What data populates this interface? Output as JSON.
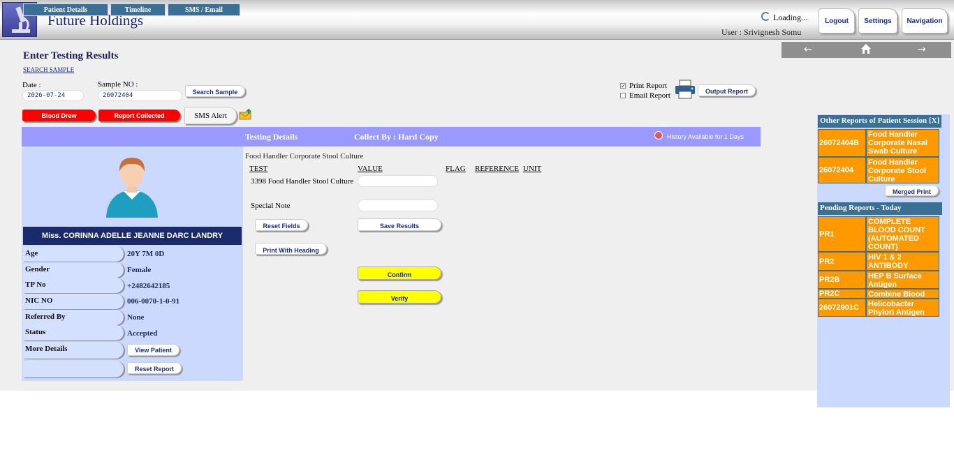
{
  "header": {
    "app_title": "Future Holdings",
    "loading_text": "Loading...",
    "user_text": "User : Srivignesh Somu",
    "logout_label": "Logout",
    "settings_label": "Settings",
    "navigation_label": "Navigation"
  },
  "page": {
    "title": "Enter Testing Results",
    "search_sample_link": "SEARCH SAMPLE"
  },
  "form": {
    "date_label": "Date :",
    "date_value": "2026-07-24",
    "sample_label": "Sample NO :",
    "sample_value": "26072404",
    "search_button": "Search Sample",
    "print_report_label": "Print Report",
    "print_report_checked": true,
    "email_report_label": "Email Report",
    "email_report_checked": false,
    "output_report_button": "Output Report"
  },
  "status_buttons": {
    "blood_drew": "Blood Drew",
    "report_collected": "Report Collected",
    "sms_alert": "SMS Alert"
  },
  "tabs": {
    "patient_details": "Patient Details",
    "timeline": "Timeline",
    "sms_email": "SMS / Email",
    "testing_details": "Testing Details",
    "collect_by": "Collect By : Hard Copy",
    "history": "History Available for 1 Days"
  },
  "patient": {
    "name": "Miss. CORINNA ADELLE JEANNE DARC LANDRY",
    "fields": [
      {
        "label": "Age",
        "value": "20Y 7M 0D"
      },
      {
        "label": "Gender",
        "value": "Female"
      },
      {
        "label": "TP No",
        "value": "+2482642185"
      },
      {
        "label": "NIC NO",
        "value": "006-0070-1-0-91"
      },
      {
        "label": "Referred By",
        "value": "None"
      },
      {
        "label": "Status",
        "value": "Accepted"
      }
    ],
    "more_details_label": "More Details",
    "view_patient_button": "View Patient",
    "reset_report_button": "Reset Report"
  },
  "results": {
    "test_title": "Food Handler Corporate Stool Culture",
    "col_test": "TEST",
    "col_value": "VALUE",
    "col_flag": "FLAG",
    "col_reference": "REFERENCE",
    "col_unit": "UNIT",
    "test_row_label": "3398 Food Handler Stool Culture",
    "test_row_value": "",
    "special_note_label": "Special Note",
    "special_note_value": "",
    "reset_fields_button": "Reset Fields",
    "save_results_button": "Save Results",
    "print_heading_button": "Print With Heading",
    "confirm_button": "Confirm",
    "verify_button": "Verify"
  },
  "other_reports": {
    "title": "Other Reports of Patient Session",
    "close_label": "[X]",
    "items": [
      {
        "id": "26072404B",
        "name": "Food Handler Corporate Nasal Swab Culture"
      },
      {
        "id": "26072404",
        "name": "Food Handler Corporate Stool Culture"
      }
    ],
    "merged_print_button": "Merged Print"
  },
  "pending_reports": {
    "title": "Pending Reports - Today",
    "items": [
      {
        "id": "PR1",
        "name": "COMPLETE BLOOD COUNT (AUTOMATED COUNT)"
      },
      {
        "id": "PR2",
        "name": "HIV 1 & 2 ANTIBODY"
      },
      {
        "id": "PR2B",
        "name": "HEP B Surface Antigen"
      },
      {
        "id": "PR2C",
        "name": "Combine Blood Tests"
      },
      {
        "id": "26072901C",
        "name": "Helicobacter Phylori Antigen"
      }
    ]
  },
  "colors": {
    "accent_blue": "#3a6f96",
    "tab_bar": "#9999ff",
    "panel_bg": "#ccd9ff",
    "alert_red": "#ff0000",
    "pending_orange": "#ff9900",
    "confirm_yellow": "#ffff00"
  }
}
